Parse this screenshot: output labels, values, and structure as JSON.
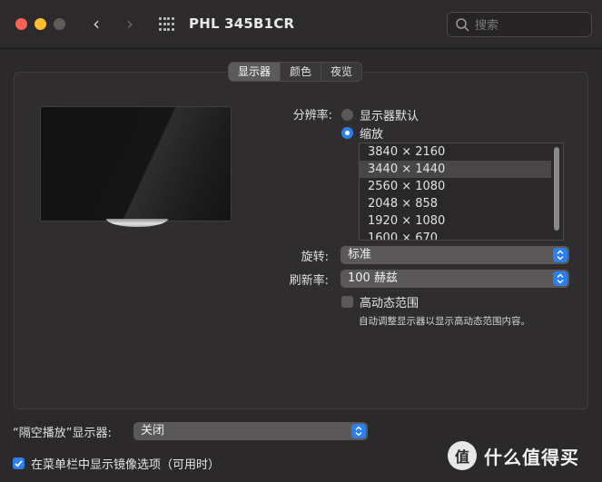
{
  "window": {
    "title": "PHL 345B1CR"
  },
  "search": {
    "placeholder": "搜索"
  },
  "tabs": [
    {
      "label": "显示器",
      "active": true
    },
    {
      "label": "颜色",
      "active": false
    },
    {
      "label": "夜览",
      "active": false
    }
  ],
  "resolution": {
    "label": "分辨率:",
    "options": [
      {
        "label": "显示器默认",
        "selected": false
      },
      {
        "label": "缩放",
        "selected": true
      }
    ],
    "list": [
      "3840 × 2160",
      "3440 × 1440",
      "2560 × 1080",
      "2048 × 858",
      "1920 × 1080",
      "1600 × 670"
    ],
    "selected_index": 1
  },
  "rotation": {
    "label": "旋转:",
    "value": "标准"
  },
  "refresh": {
    "label": "刷新率:",
    "value": "100 赫兹"
  },
  "hdr": {
    "label": "高动态范围",
    "checked": false,
    "hint": "自动调整显示器以显示高动态范围内容。"
  },
  "airplay": {
    "label": "“隔空播放”显示器:",
    "value": "关闭"
  },
  "menubar": {
    "label": "在菜单栏中显示镜像选项（可用时）",
    "checked": true
  },
  "watermark": {
    "text": "什么值得买",
    "icon_glyph": "值"
  },
  "colors": {
    "accent": "#2b7ff0",
    "close": "#fe5f57",
    "minimize": "#febc2e"
  }
}
